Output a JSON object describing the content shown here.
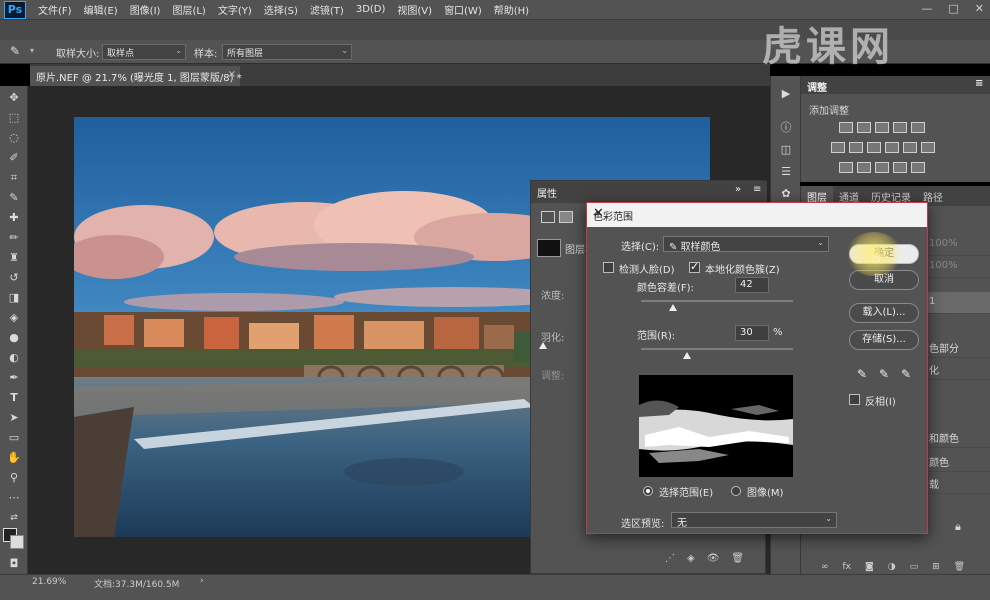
{
  "app": {
    "logo": "Ps",
    "menus": [
      "文件(F)",
      "编辑(E)",
      "图像(I)",
      "图层(L)",
      "文字(Y)",
      "选择(S)",
      "滤镜(T)",
      "3D(D)",
      "视图(V)",
      "窗口(W)",
      "帮助(H)"
    ],
    "window_controls": [
      "—",
      "□",
      "✕"
    ]
  },
  "options_bar": {
    "sample_size_label": "取样大小:",
    "sample_size_value": "取样点",
    "sample_label": "样本:",
    "sample_value": "所有图层"
  },
  "document": {
    "tab_title": "原片.NEF @ 21.7% (曝光度 1, 图层蒙版/8) *",
    "close": "×"
  },
  "status_bar": {
    "zoom": "21.69%",
    "doc_info": "文档:37.3M/160.5M"
  },
  "adjustments_panel": {
    "tab": "调整",
    "add_label": "添加调整"
  },
  "layers_panel": {
    "tabs": [
      "图层",
      "通道",
      "历史记录",
      "路径"
    ],
    "visible_fragments": [
      "100%",
      "100%",
      "1",
      "色部分",
      "化",
      "和颜色",
      "颜色",
      "载"
    ]
  },
  "properties_panel": {
    "title": "属性",
    "row_mask": "图层蒙版",
    "density_label": "浓度:",
    "feather_label": "羽化:",
    "adjust_label": "调整:"
  },
  "color_range_dialog": {
    "title": "色彩范围",
    "select_label": "选择(C):",
    "select_value": "取样颜色",
    "detect_faces_label": "检测人脸(D)",
    "detect_faces_checked": false,
    "localized_label": "本地化颜色簇(Z)",
    "localized_checked": true,
    "fuzziness_label": "颜色容差(F):",
    "fuzziness_value": "42",
    "fuzziness_fraction": 0.21,
    "range_label": "范围(R):",
    "range_value": "30",
    "range_unit": "%",
    "range_fraction": 0.3,
    "radio_selection_label": "选择范围(E)",
    "radio_image_label": "图像(M)",
    "radio_selected": "selection",
    "preview_label": "选区预览:",
    "preview_value": "无",
    "ok_label": "确定",
    "cancel_label": "取消",
    "load_label": "载入(L)...",
    "save_label": "存储(S)...",
    "invert_label": "反相(I)",
    "invert_checked": false
  },
  "watermark": "虎课网"
}
